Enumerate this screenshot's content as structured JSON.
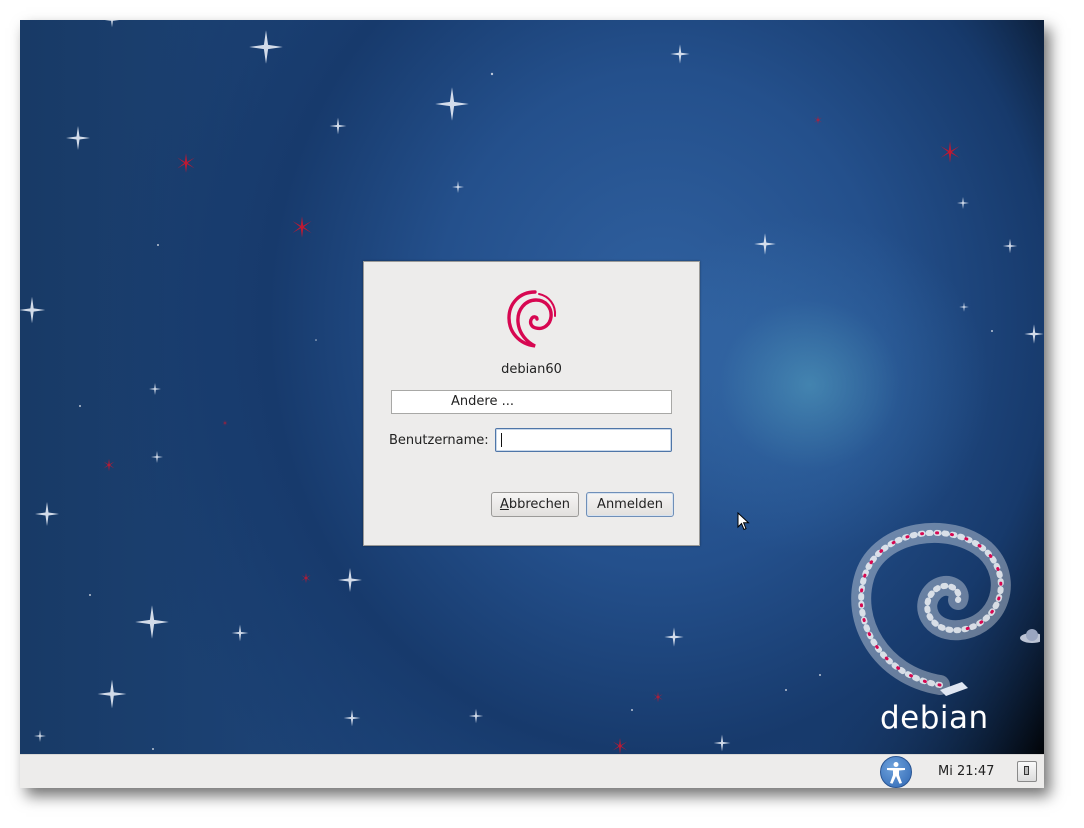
{
  "login": {
    "hostname": "debian60",
    "user_select": {
      "selected": "Andere ..."
    },
    "username_label": "Benutzername:",
    "username_value": "",
    "cancel_label_prefix": "",
    "cancel_label_mnemonic": "A",
    "cancel_label_rest": "bbrechen",
    "login_label": "Anmelden"
  },
  "desktop": {
    "brand_wordmark": "debian",
    "accent_red": "#d70751",
    "background_blue": "#24508c"
  },
  "panel": {
    "clock": "Mi 21:47",
    "icons": [
      "accessibility-icon",
      "shutdown-icon"
    ]
  }
}
